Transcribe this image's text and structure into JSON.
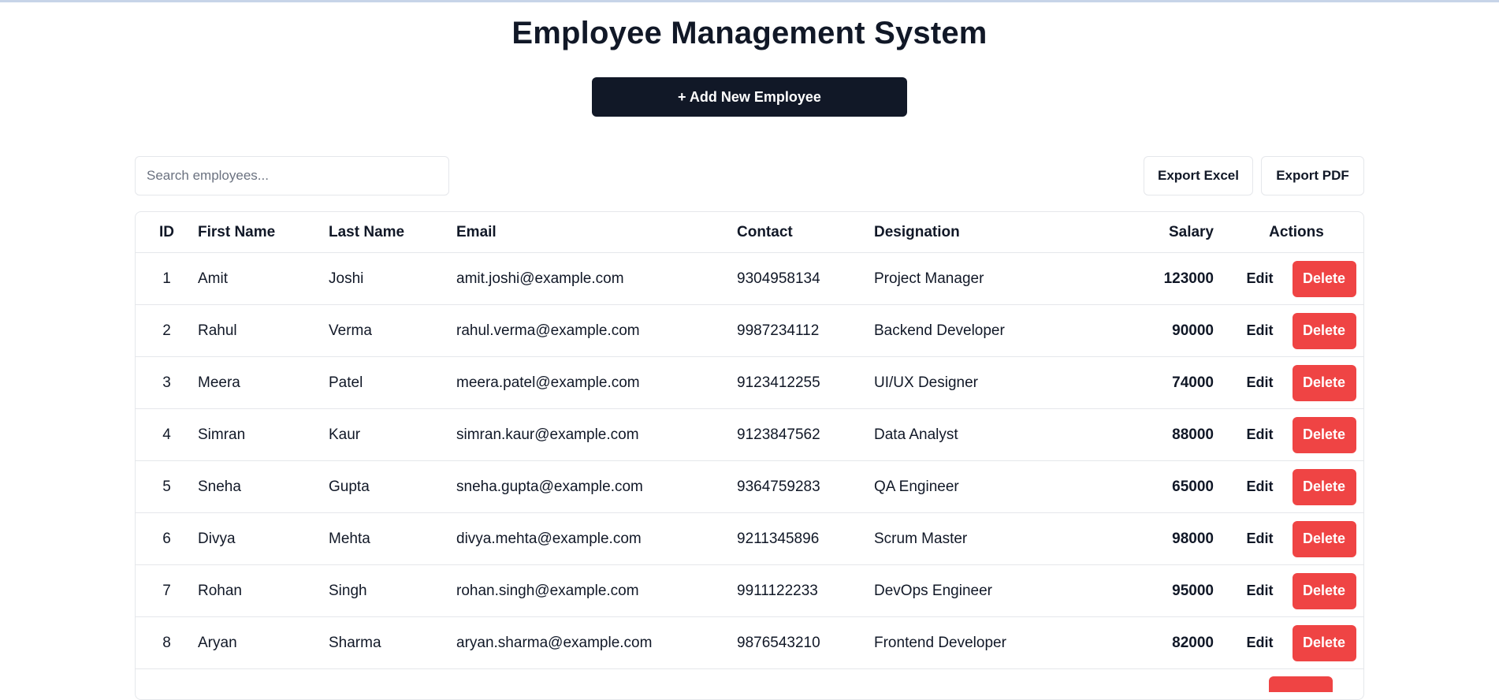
{
  "page": {
    "title": "Employee Management System",
    "add_button_label": "+ Add New Employee"
  },
  "toolbar": {
    "search_placeholder": "Search employees...",
    "search_value": "",
    "export_excel_label": "Export Excel",
    "export_pdf_label": "Export PDF"
  },
  "table": {
    "headers": {
      "id": "ID",
      "first_name": "First Name",
      "last_name": "Last Name",
      "email": "Email",
      "contact": "Contact",
      "designation": "Designation",
      "salary": "Salary",
      "actions": "Actions"
    },
    "edit_label": "Edit",
    "delete_label": "Delete",
    "rows": [
      {
        "id": "1",
        "first": "Amit",
        "last": "Joshi",
        "email": "amit.joshi@example.com",
        "contact": "9304958134",
        "designation": "Project Manager",
        "salary": "123000"
      },
      {
        "id": "2",
        "first": "Rahul",
        "last": "Verma",
        "email": "rahul.verma@example.com",
        "contact": "9987234112",
        "designation": "Backend Developer",
        "salary": "90000"
      },
      {
        "id": "3",
        "first": "Meera",
        "last": "Patel",
        "email": "meera.patel@example.com",
        "contact": "9123412255",
        "designation": "UI/UX Designer",
        "salary": "74000"
      },
      {
        "id": "4",
        "first": "Simran",
        "last": "Kaur",
        "email": "simran.kaur@example.com",
        "contact": "9123847562",
        "designation": "Data Analyst",
        "salary": "88000"
      },
      {
        "id": "5",
        "first": "Sneha",
        "last": "Gupta",
        "email": "sneha.gupta@example.com",
        "contact": "9364759283",
        "designation": "QA Engineer",
        "salary": "65000"
      },
      {
        "id": "6",
        "first": "Divya",
        "last": "Mehta",
        "email": "divya.mehta@example.com",
        "contact": "9211345896",
        "designation": "Scrum Master",
        "salary": "98000"
      },
      {
        "id": "7",
        "first": "Rohan",
        "last": "Singh",
        "email": "rohan.singh@example.com",
        "contact": "9911122233",
        "designation": "DevOps Engineer",
        "salary": "95000"
      },
      {
        "id": "8",
        "first": "Aryan",
        "last": "Sharma",
        "email": "aryan.sharma@example.com",
        "contact": "9876543210",
        "designation": "Frontend Developer",
        "salary": "82000"
      }
    ]
  },
  "colors": {
    "primary": "#111827",
    "danger": "#ef4444",
    "border": "#e5e7eb"
  }
}
